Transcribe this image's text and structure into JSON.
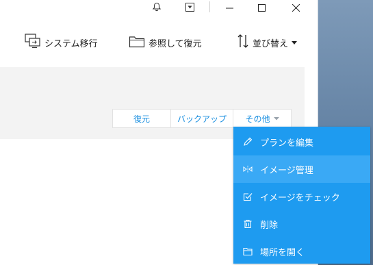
{
  "toolbar": {
    "system_migration": "システム移行",
    "browse_restore": "参照して復元",
    "sort": "並び替え"
  },
  "card": {
    "actions": [
      "復元",
      "バックアップ",
      "その他"
    ]
  },
  "menu": {
    "items": [
      {
        "label": "プランを編集",
        "icon": "pencil-icon"
      },
      {
        "label": "イメージ管理",
        "icon": "split-arrows-icon"
      },
      {
        "label": "イメージをチェック",
        "icon": "checkbox-icon"
      },
      {
        "label": "削除",
        "icon": "trash-icon"
      },
      {
        "label": "場所を開く",
        "icon": "folder-icon"
      }
    ],
    "highlighted_index": 1
  },
  "colors": {
    "accent": "#1e9bf0",
    "menu_bg": "#1e9bf0",
    "menu_highlight": "#3aa9f5",
    "link_text": "#1a8fe0"
  }
}
